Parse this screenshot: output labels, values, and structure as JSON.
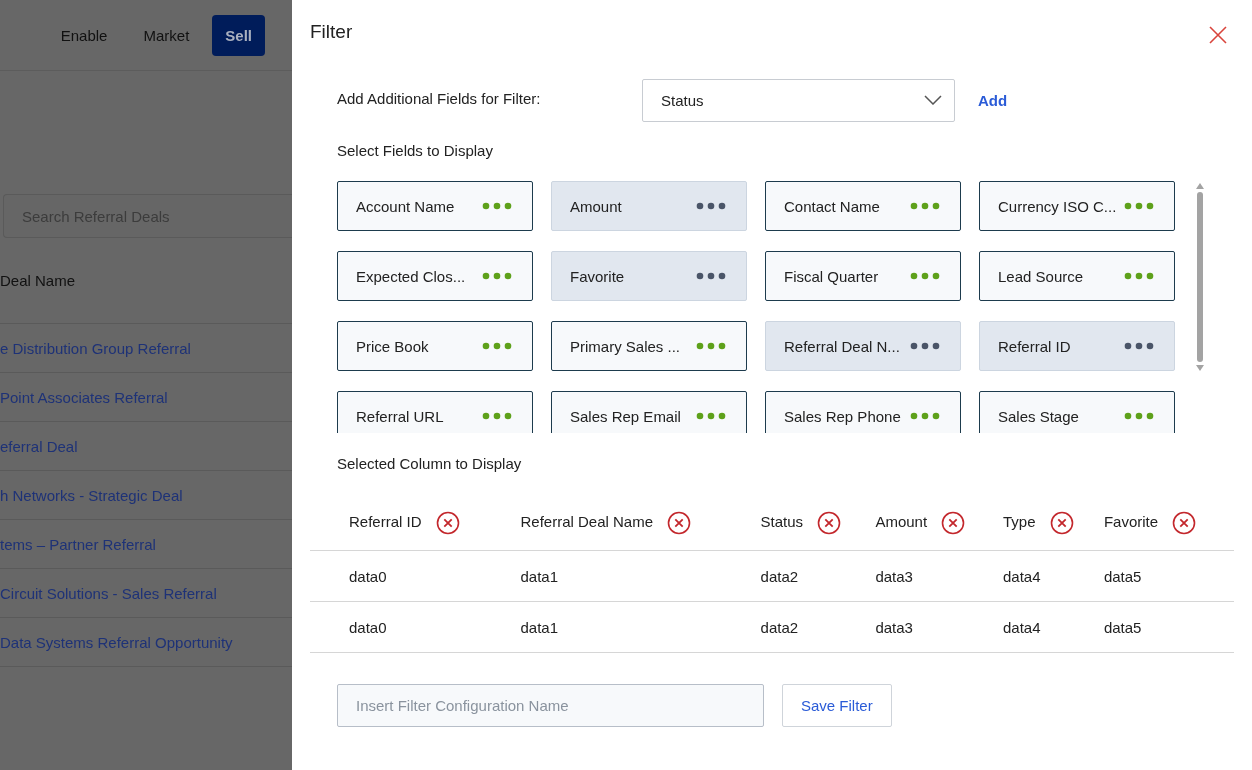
{
  "background": {
    "nav": [
      {
        "label": "Enable",
        "selected": false
      },
      {
        "label": "Market",
        "selected": false
      },
      {
        "label": "Sell",
        "selected": true
      }
    ],
    "search": {
      "placeholder": "Search Referral Deals"
    },
    "table": {
      "column": "Deal Name",
      "rows": [
        "e Distribution Group Referral",
        "Point Associates Referral",
        "eferral Deal",
        "h Networks - Strategic Deal",
        "tems – Partner Referral",
        "Circuit Solutions - Sales Referral",
        "Data Systems Referral Opportunity"
      ]
    }
  },
  "drawer": {
    "title": "Filter",
    "add_field": {
      "label": "Add Additional Fields for Filter:",
      "value": "Status",
      "button": "Add"
    },
    "fields_heading": "Select Fields to Display",
    "fields": [
      {
        "label": "Account Name",
        "selected": false
      },
      {
        "label": "Amount",
        "selected": true
      },
      {
        "label": "Contact Name",
        "selected": false
      },
      {
        "label": "Currency ISO C...",
        "selected": false
      },
      {
        "label": "Expected Clos...",
        "selected": false
      },
      {
        "label": "Favorite",
        "selected": true
      },
      {
        "label": "Fiscal Quarter",
        "selected": false
      },
      {
        "label": "Lead Source",
        "selected": false
      },
      {
        "label": "Price Book",
        "selected": false
      },
      {
        "label": "Primary Sales ...",
        "selected": false
      },
      {
        "label": "Referral Deal N...",
        "selected": true
      },
      {
        "label": "Referral ID",
        "selected": true
      },
      {
        "label": "Referral URL",
        "selected": false
      },
      {
        "label": "Sales Rep Email",
        "selected": false
      },
      {
        "label": "Sales Rep Phone",
        "selected": false
      },
      {
        "label": "Sales Stage",
        "selected": false
      }
    ],
    "columns_heading": "Selected Column to Display",
    "columns": [
      "Referral ID",
      "Referral Deal Name",
      "Status",
      "Amount",
      "Type",
      "Favorite"
    ],
    "rows": [
      [
        "data0",
        "data1",
        "data2",
        "data3",
        "data4",
        "data5"
      ],
      [
        "data0",
        "data1",
        "data2",
        "data3",
        "data4",
        "data5"
      ]
    ],
    "name_field": {
      "placeholder": "Insert Filter Configuration Name"
    },
    "save_button": "Save Filter"
  }
}
